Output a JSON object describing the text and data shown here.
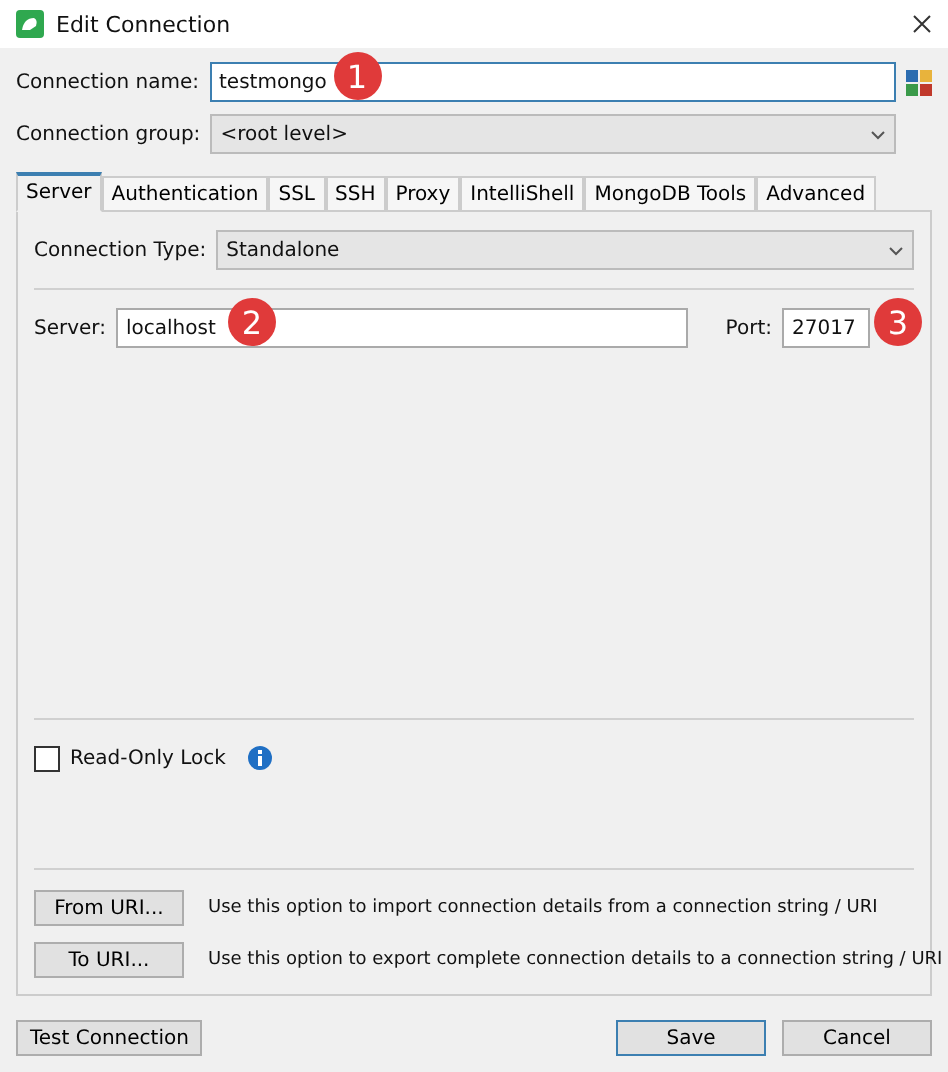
{
  "window": {
    "title": "Edit Connection"
  },
  "connection_name": {
    "label": "Connection name:",
    "value": "testmongo",
    "badge": "1"
  },
  "connection_group": {
    "label": "Connection group:",
    "value": "<root level>"
  },
  "tabs": [
    {
      "label": "Server",
      "selected": true
    },
    {
      "label": "Authentication",
      "selected": false
    },
    {
      "label": "SSL",
      "selected": false
    },
    {
      "label": "SSH",
      "selected": false
    },
    {
      "label": "Proxy",
      "selected": false
    },
    {
      "label": "IntelliShell",
      "selected": false
    },
    {
      "label": "MongoDB Tools",
      "selected": false
    },
    {
      "label": "Advanced",
      "selected": false
    }
  ],
  "connection_type": {
    "label": "Connection Type:",
    "value": "Standalone"
  },
  "server": {
    "label": "Server:",
    "value": "localhost",
    "badge": "2"
  },
  "port": {
    "label": "Port:",
    "value": "27017",
    "badge": "3"
  },
  "read_only_lock": {
    "label": "Read-Only Lock",
    "checked": false
  },
  "uri_actions": [
    {
      "button": "From URI...",
      "description": "Use this option to import connection details from a connection string / URI"
    },
    {
      "button": "To URI...",
      "description": "Use this option to export complete connection details to a connection string / URI"
    }
  ],
  "footer_buttons": [
    {
      "label": "Test Connection",
      "kind": "plain"
    },
    {
      "label": "Save",
      "kind": "default"
    },
    {
      "label": "Cancel",
      "kind": "plain"
    }
  ]
}
